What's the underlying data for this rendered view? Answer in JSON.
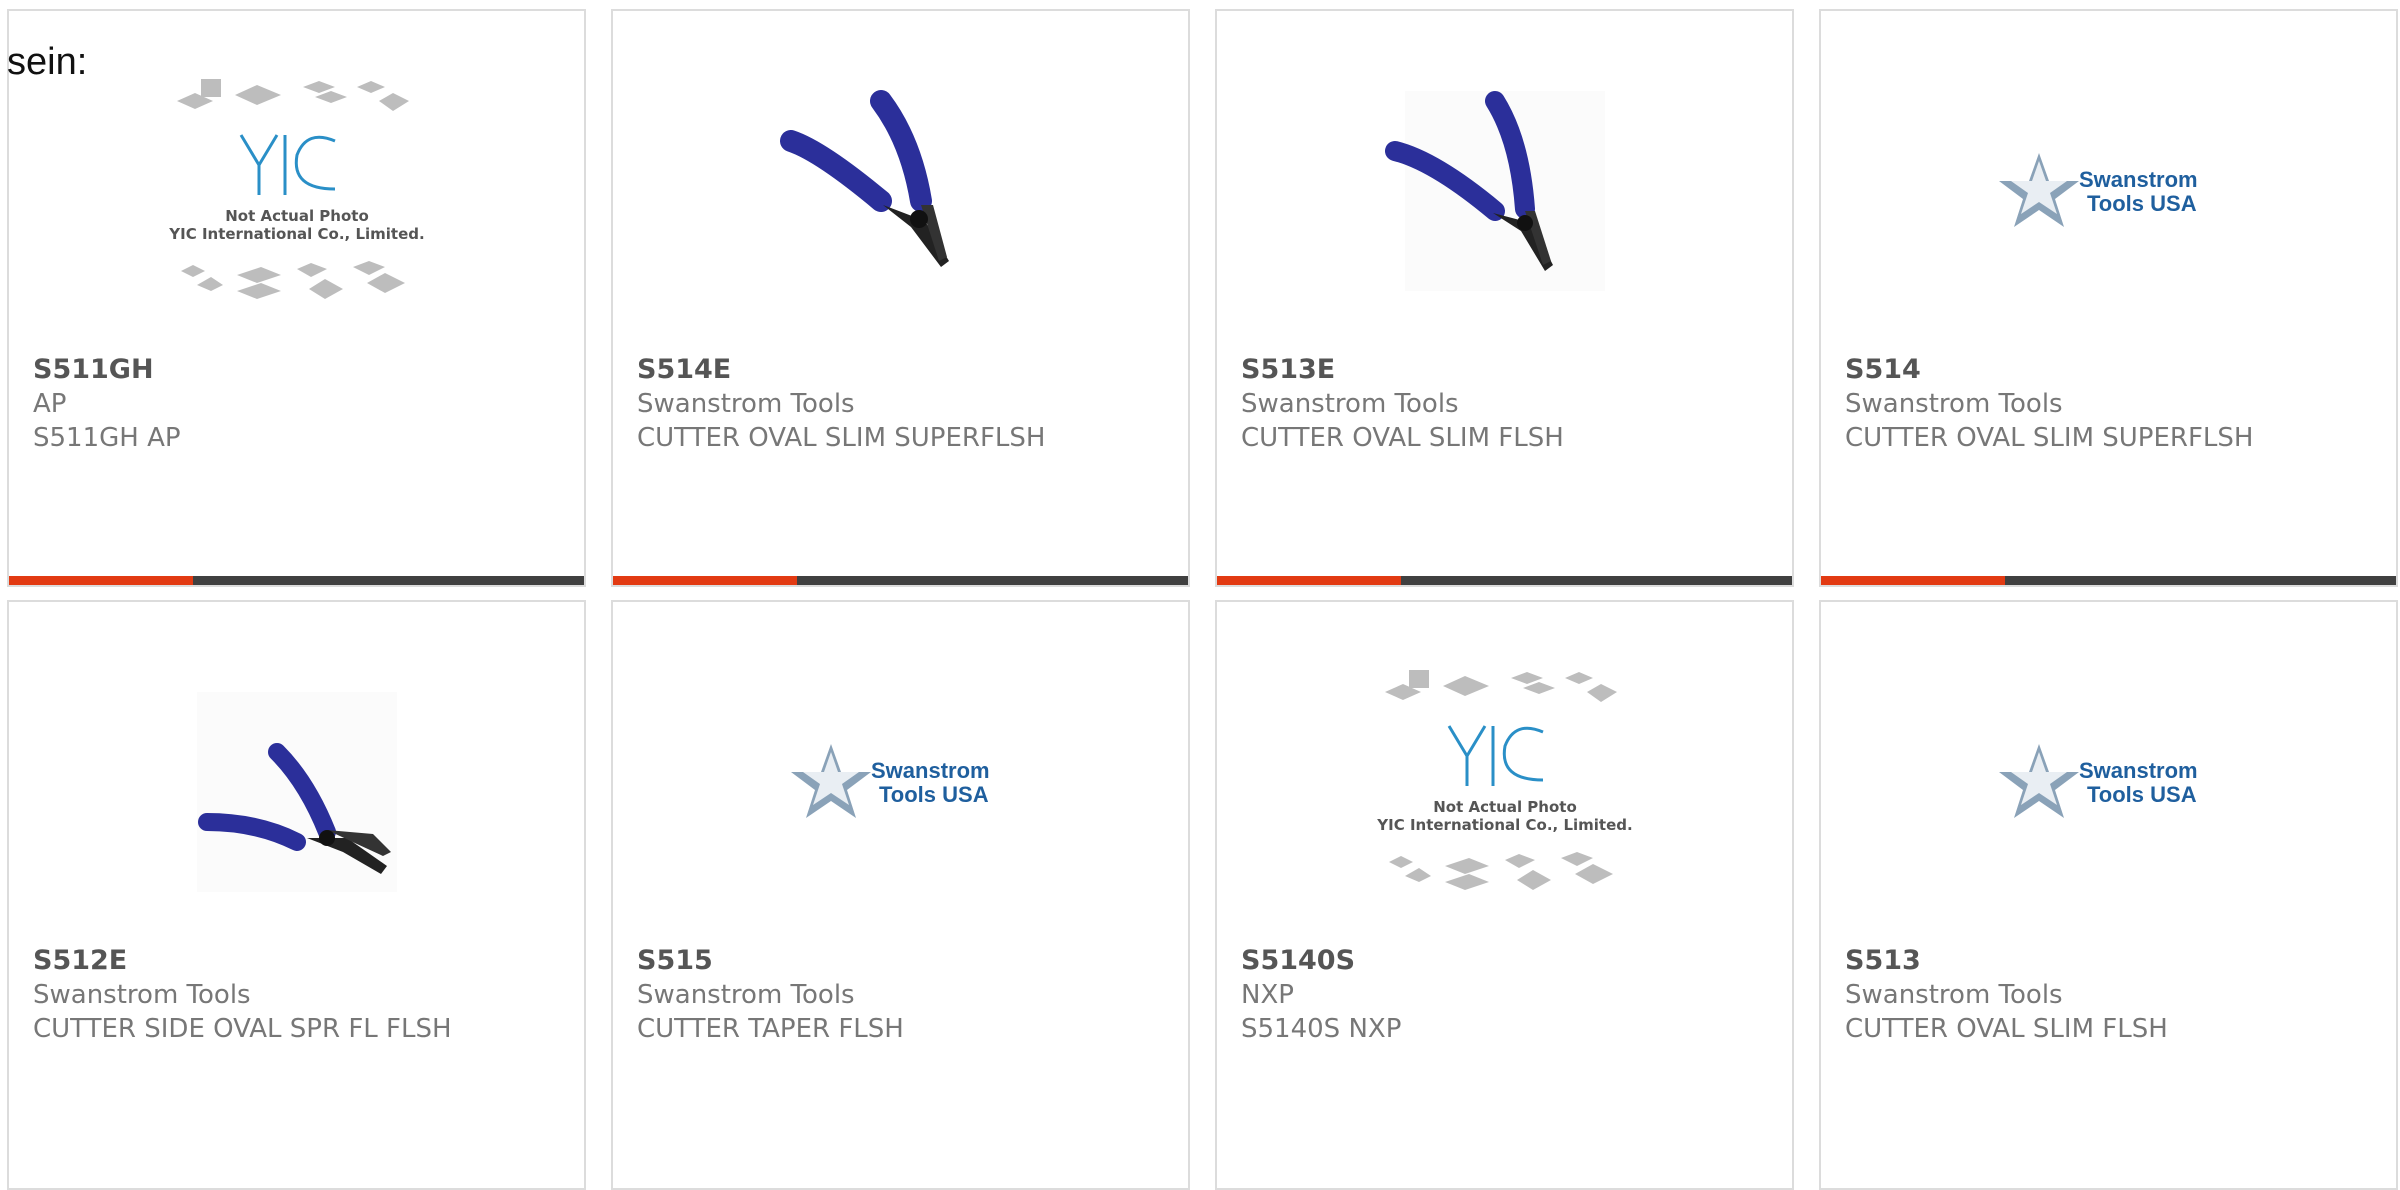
{
  "intro_text": "sein:",
  "colors": {
    "accent": "#e23a12",
    "bar_track": "#404040",
    "card_border": "#dcdcdc",
    "part_number": "#555555",
    "meta_text": "#777777"
  },
  "products": [
    {
      "part_number": "S511GH",
      "manufacturer": "AP",
      "description": "S511GH AP",
      "image": "yic-not-actual-photo",
      "image_caption_1": "Not Actual Photo",
      "image_caption_2": "YIC International Co., Limited.",
      "progress": 0.32
    },
    {
      "part_number": "S514E",
      "manufacturer": "Swanstrom Tools",
      "description": "CUTTER OVAL SLIM SUPERFLSH",
      "image": "blue-cutter-photo",
      "progress": 0.32
    },
    {
      "part_number": "S513E",
      "manufacturer": "Swanstrom Tools",
      "description": "CUTTER OVAL SLIM FLSH",
      "image": "blue-cutter-photo",
      "progress": 0.32
    },
    {
      "part_number": "S514",
      "manufacturer": "Swanstrom Tools",
      "description": "CUTTER OVAL SLIM SUPERFLSH",
      "image": "swanstrom-logo",
      "logo_line_1": "Swanstrom",
      "logo_line_2": "Tools USA",
      "progress": 0.32
    },
    {
      "part_number": "S512E",
      "manufacturer": "Swanstrom Tools",
      "description": "CUTTER SIDE OVAL SPR FL FLSH",
      "image": "blue-cutter-photo"
    },
    {
      "part_number": "S515",
      "manufacturer": "Swanstrom Tools",
      "description": "CUTTER TAPER FLSH",
      "image": "swanstrom-logo",
      "logo_line_1": "Swanstrom",
      "logo_line_2": "Tools USA"
    },
    {
      "part_number": "S5140S",
      "manufacturer": "NXP",
      "description": "S5140S NXP",
      "image": "yic-not-actual-photo",
      "image_caption_1": "Not Actual Photo",
      "image_caption_2": "YIC International Co., Limited."
    },
    {
      "part_number": "S513",
      "manufacturer": "Swanstrom Tools",
      "description": "CUTTER OVAL SLIM FLSH",
      "image": "swanstrom-logo",
      "logo_line_1": "Swanstrom",
      "logo_line_2": "Tools USA"
    }
  ]
}
